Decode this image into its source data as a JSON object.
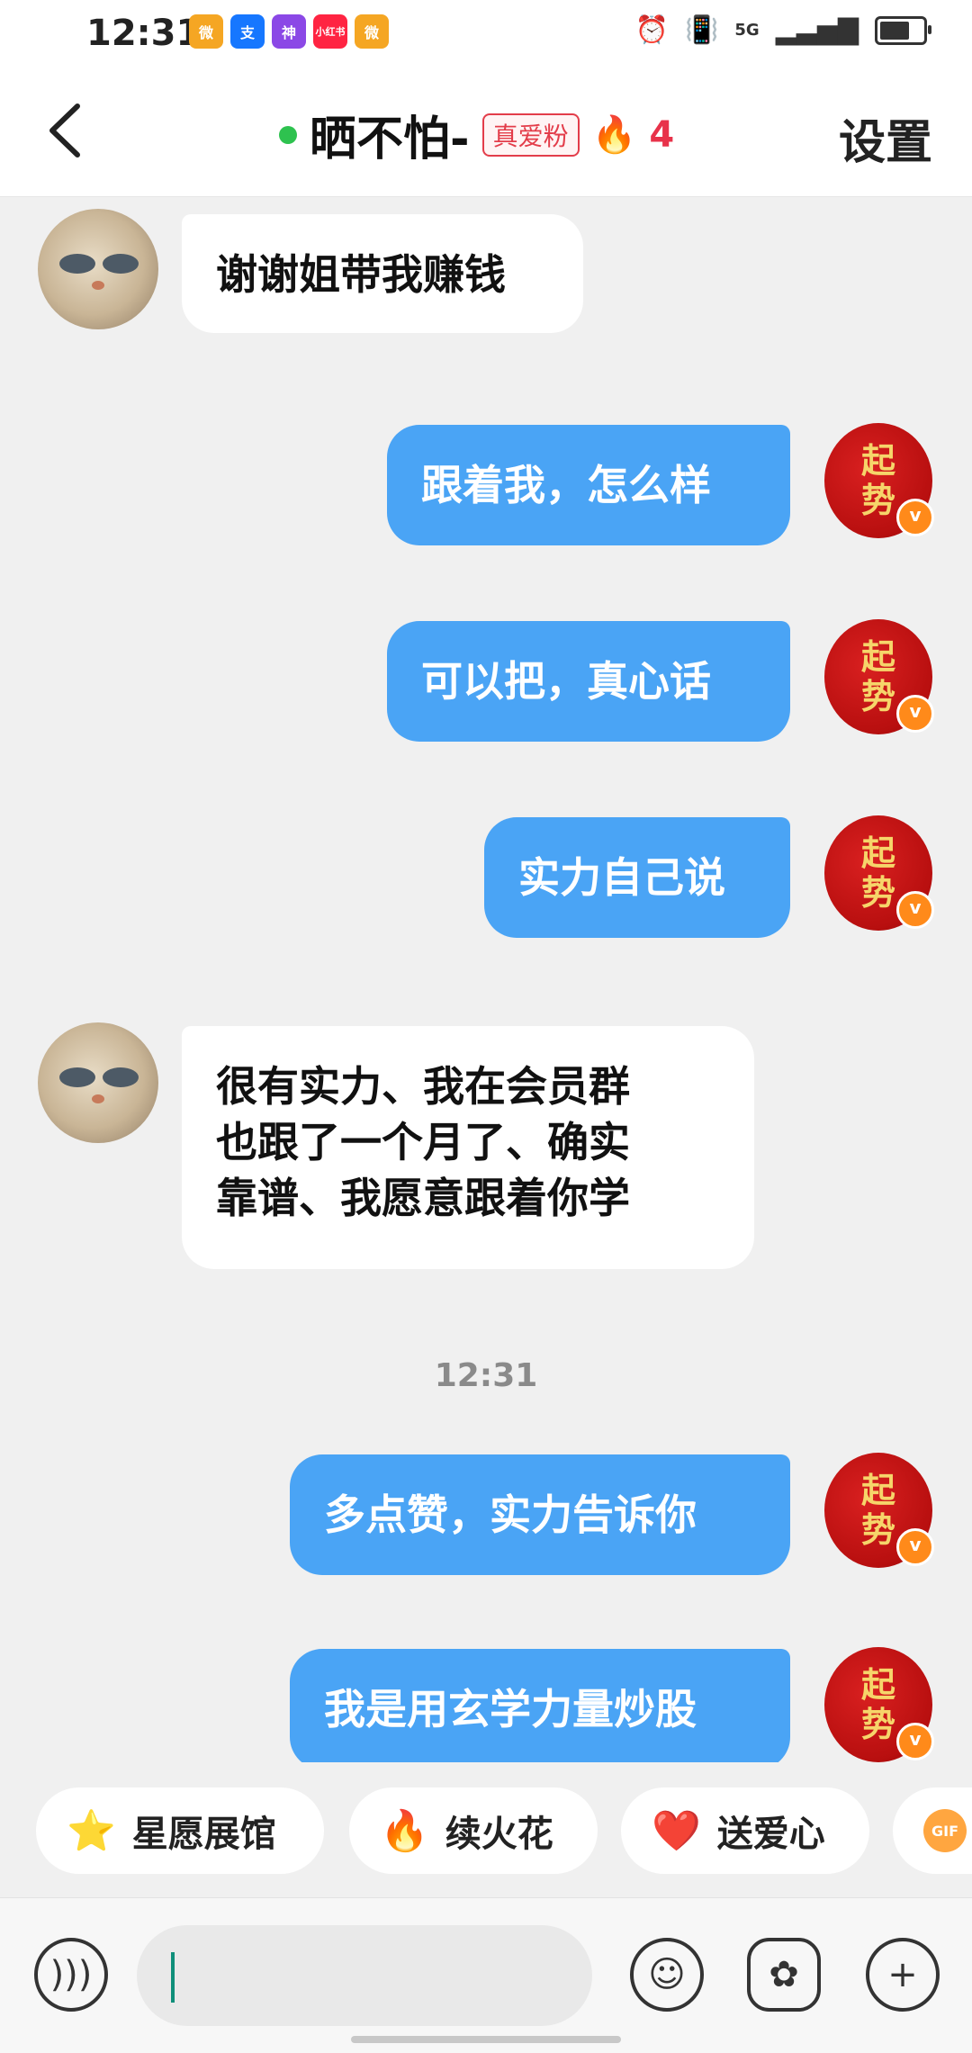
{
  "status_bar": {
    "time": "12:31",
    "apps": [
      {
        "name": "weibo",
        "label": "微",
        "color": "#f5a623"
      },
      {
        "name": "alipay",
        "label": "支",
        "color": "#1677ff"
      },
      {
        "name": "app-purple",
        "label": "神",
        "color": "#8b48e6"
      },
      {
        "name": "xiaohongshu",
        "label": "小红书",
        "color": "#ff2442"
      },
      {
        "name": "weibo-2",
        "label": "微",
        "color": "#f5a623"
      }
    ],
    "network": "5G",
    "battery_level": 0.7
  },
  "header": {
    "title": "晒不怕-",
    "fan_badge": "真爱粉",
    "streak_count": "4",
    "settings_label": "设置"
  },
  "messages": [
    {
      "side": "in",
      "text": "谢谢姐带我赚钱"
    },
    {
      "side": "out",
      "text": "跟着我，怎么样"
    },
    {
      "side": "out",
      "text": "可以把，真心话"
    },
    {
      "side": "out",
      "text": "实力自己说"
    },
    {
      "side": "in",
      "lines": [
        "很有实力、我在会员群",
        "也跟了一个月了、确实",
        "靠谱、我愿意跟着你学"
      ]
    },
    {
      "side": "time",
      "text": "12:31"
    },
    {
      "side": "out",
      "text": "多点赞，实力告诉你"
    },
    {
      "side": "out",
      "text": "我是用玄学力量炒股"
    }
  ],
  "avatar_right_text": [
    "起",
    "势"
  ],
  "chips": [
    "星愿展馆",
    "续火花",
    "送爱心"
  ],
  "gif_label": "GIF",
  "input": {
    "placeholder": ""
  },
  "colors": {
    "outgoing_bubble": "#4aa4f5",
    "incoming_bubble": "#ffffff",
    "online": "#2ec24f",
    "fan_badge": "#e33d4a"
  }
}
